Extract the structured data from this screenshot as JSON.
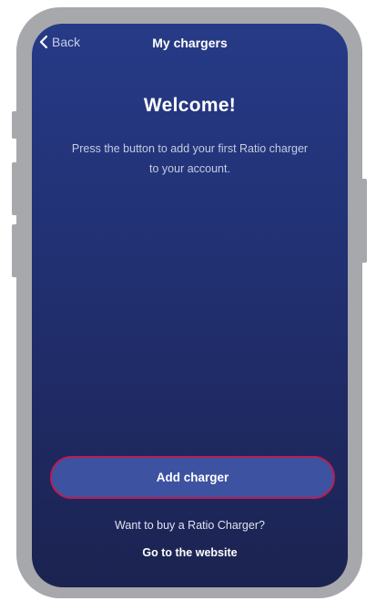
{
  "header": {
    "back_label": "Back",
    "title": "My chargers"
  },
  "welcome": {
    "title": "Welcome!",
    "text": "Press the button to add your first Ratio charger to your account."
  },
  "actions": {
    "add_charger_label": "Add charger",
    "buy_question": "Want to buy a Ratio Charger?",
    "website_link": "Go to the website"
  },
  "colors": {
    "background_top": "#263a86",
    "background_bottom": "#1b2350",
    "button_fill": "#3d52a1",
    "button_highlight": "#b81f53",
    "frame": "#a7a8ab"
  },
  "icons": {
    "back": "chevron-left-icon"
  }
}
